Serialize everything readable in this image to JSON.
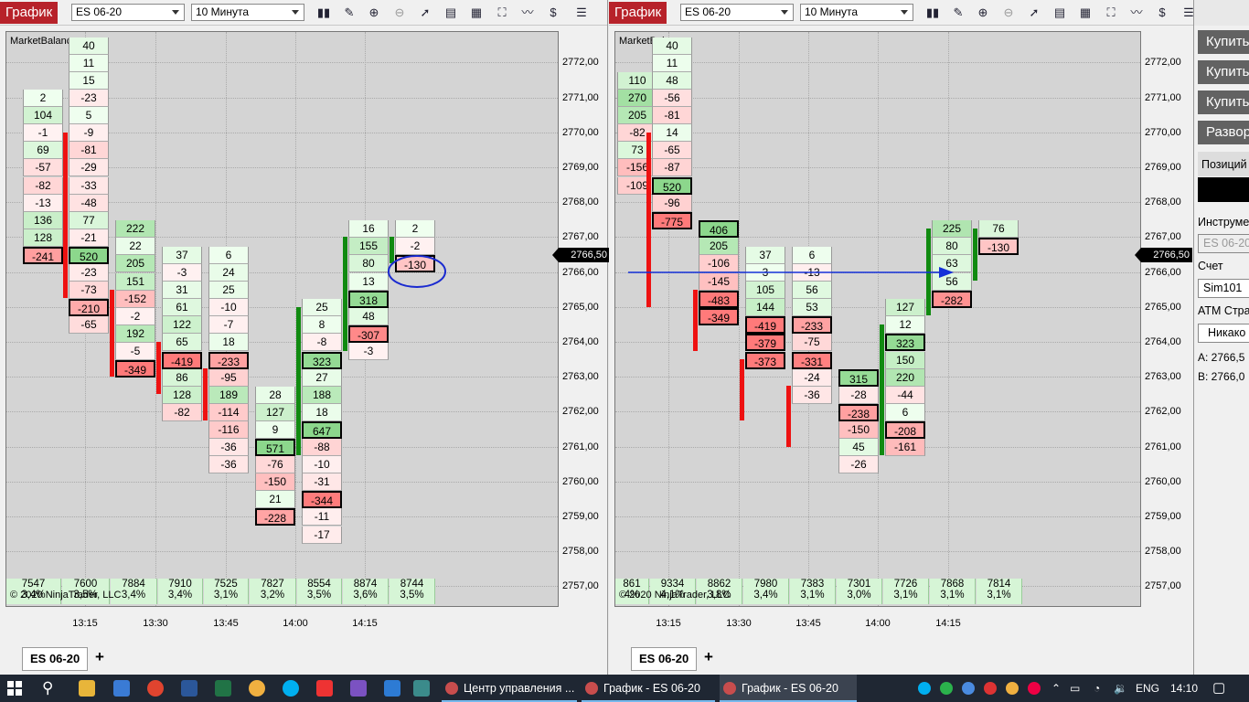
{
  "left": {
    "title": "График",
    "instrument": "ES 06-20",
    "interval": "10 Минута",
    "indicator": "MarketBalance",
    "copyright": "© 2020 NinjaTrader, LLC",
    "tab": "ES 06-20",
    "current_price": "2766,50",
    "times": [
      "13:15",
      "13:30",
      "13:45",
      "14:00",
      "14:15"
    ],
    "sums": [
      {
        "v": "7547",
        "p": "3,4%"
      },
      {
        "v": "7600",
        "p": "3,5%"
      },
      {
        "v": "7884",
        "p": "3,4%"
      },
      {
        "v": "7910",
        "p": "3,4%"
      },
      {
        "v": "7525",
        "p": "3,1%"
      },
      {
        "v": "7827",
        "p": "3,2%"
      },
      {
        "v": "8554",
        "p": "3,5%"
      },
      {
        "v": "8874",
        "p": "3,6%"
      },
      {
        "v": "8744",
        "p": "3,5%"
      }
    ],
    "columns": [
      {
        "top": "2772,00",
        "cells": [
          "",
          "",
          "",
          "",
          "",
          "",
          "",
          ""
        ],
        "bar": null,
        "hide": true
      },
      {
        "top": "2770,75",
        "cells": [
          "2",
          "104",
          "-1",
          "69",
          "-57",
          "-82",
          "-13",
          "136",
          "128",
          "-241"
        ],
        "bar": null
      },
      {
        "top": "2772,25",
        "cells": [
          "40",
          "11",
          "15",
          "-23",
          "5",
          "-9",
          "-81",
          "-29",
          "-33",
          "-48",
          "77",
          "-21",
          "520",
          "-23",
          "-73",
          "-210",
          "-65"
        ],
        "bar": {
          "from": "2769,75",
          "to": "2765,50",
          "c": "red"
        }
      },
      {
        "top": "2767,00",
        "cells": [
          "222",
          "22",
          "205",
          "151",
          "-152",
          "-2",
          "192",
          "-5",
          "-349"
        ],
        "bar": {
          "from": "2765,25",
          "to": "2763,25",
          "c": "red"
        }
      },
      {
        "top": "2766,25",
        "cells": [
          "37",
          "-3",
          "31",
          "61",
          "122",
          "65",
          "-419",
          "86",
          "128",
          "-82"
        ],
        "bar": {
          "from": "2763,75",
          "to": "2762,75",
          "c": "red"
        }
      },
      {
        "top": "2766,25",
        "cells": [
          "6",
          "24",
          "25",
          "-10",
          "-7",
          "18",
          "-233",
          "-95",
          "189",
          "-114",
          "-116",
          "-36",
          "-36"
        ],
        "bar": {
          "from": "2763,00",
          "to": "2762,00",
          "c": "red"
        }
      },
      {
        "top": "2762,25",
        "cells": [
          "28",
          "127",
          "9",
          "571",
          "-76",
          "-150",
          "21",
          "-228"
        ],
        "bar": null
      },
      {
        "top": "2764,75",
        "cells": [
          "25",
          "8",
          "-8",
          "323",
          "27",
          "188",
          "18",
          "647",
          "-88",
          "-10",
          "-31",
          "-344",
          "-11",
          "-17"
        ],
        "bar": {
          "from": "2764,75",
          "to": "2761,00",
          "c": "green"
        }
      },
      {
        "top": "2767,00",
        "cells": [
          "16",
          "155",
          "80",
          "13",
          "318",
          "48",
          "-307",
          "-3"
        ],
        "bar": {
          "from": "2766,75",
          "to": "2764,00",
          "c": "green"
        }
      },
      {
        "top": "2767,00",
        "cells": [
          "2",
          "-2",
          "-130"
        ],
        "bar": {
          "from": "2766,75",
          "to": "2766,50",
          "c": "green"
        }
      }
    ]
  },
  "right": {
    "title": "График",
    "instrument": "ES 06-20",
    "interval": "10 Минута",
    "indicator": "MarketBalance",
    "copyright": "© 2020 NinjaTrader, LLC",
    "tab": "ES 06-20",
    "current_price": "2766,50",
    "times": [
      "13:15",
      "13:30",
      "13:45",
      "14:00",
      "14:15"
    ],
    "sums": [
      {
        "v": "861",
        "p": "4%"
      },
      {
        "v": "9334",
        "p": "4,1%"
      },
      {
        "v": "8862",
        "p": "3,8%"
      },
      {
        "v": "7980",
        "p": "3,4%"
      },
      {
        "v": "7383",
        "p": "3,1%"
      },
      {
        "v": "7301",
        "p": "3,0%"
      },
      {
        "v": "7726",
        "p": "3,1%"
      },
      {
        "v": "7868",
        "p": "3,1%"
      },
      {
        "v": "7814",
        "p": "3,1%"
      }
    ],
    "columns": [
      {
        "top": "2771,25",
        "cells": [
          "110",
          "270",
          "205",
          "-82",
          "73",
          "-156",
          "-109"
        ],
        "bar": null
      },
      {
        "top": "2772,25",
        "cells": [
          "40",
          "11",
          "48",
          "-56",
          "-81",
          "14",
          "-65",
          "-87",
          "520",
          "-96",
          "-775"
        ],
        "bar": {
          "from": "2769,75",
          "to": "2765,25",
          "c": "red"
        }
      },
      {
        "top": "2767,00",
        "cells": [
          "406",
          "205",
          "-106",
          "-145",
          "-483",
          "-349"
        ],
        "bar": {
          "from": "2765,25",
          "to": "2764,00",
          "c": "red"
        }
      },
      {
        "top": "2766,25",
        "cells": [
          "37",
          "3",
          "105",
          "144",
          "-419",
          "-379",
          "-373"
        ],
        "bar": {
          "from": "2763,25",
          "to": "2762,00",
          "c": "red"
        }
      },
      {
        "top": "2766,25",
        "cells": [
          "6",
          "-13",
          "56",
          "53",
          "-233",
          "-75",
          "-331",
          "-24",
          "-36"
        ],
        "bar": {
          "from": "2762,50",
          "to": "2761,25",
          "c": "red"
        }
      },
      {
        "top": "2762,75",
        "cells": [
          "315",
          "-28",
          "-238",
          "-150",
          "45",
          "-26"
        ],
        "bar": null
      },
      {
        "top": "2764,75",
        "cells": [
          "127",
          "12",
          "323",
          "150",
          "220",
          "-44",
          "6",
          "-208",
          "-161"
        ],
        "bar": {
          "from": "2764,25",
          "to": "2761,00",
          "c": "green"
        }
      },
      {
        "top": "2767,00",
        "cells": [
          "225",
          "80",
          "63",
          "56",
          "-282"
        ],
        "bar": {
          "from": "2767,00",
          "to": "2765,00",
          "c": "green"
        }
      },
      {
        "top": "2767,00",
        "cells": [
          "76",
          "-130"
        ],
        "bar": {
          "from": "2767,00",
          "to": "2766,00",
          "c": "green"
        }
      }
    ]
  },
  "prices": [
    "2772,00",
    "2771,00",
    "2770,00",
    "2769,00",
    "2768,00",
    "2767,00",
    "2766,00",
    "2765,00",
    "2764,00",
    "2763,00",
    "2762,00",
    "2761,00",
    "2760,00",
    "2759,00",
    "2758,00",
    "2757,00"
  ],
  "side_panel": {
    "buttons": [
      "Купить",
      "Купить",
      "Купить",
      "Развор"
    ],
    "position_label": "Позиций",
    "instrument_label": "Инструмент",
    "instrument_value": "ES 06-20",
    "account_label": "Счет",
    "account_value": "Sim101",
    "atm_label": "ATM Страт",
    "atm_value": "Никако",
    "ask": "A:  2766,5",
    "bid": "B:  2766,0"
  },
  "taskbar": {
    "items": [
      "Центр управления ...",
      "График - ES 06-20",
      "График - ES 06-20"
    ],
    "lang": "ENG",
    "time": "14:10"
  },
  "colors": {
    "title_red": "#b7222a",
    "buy_green": "#7fd97f",
    "sell_red": "#f7b7b7",
    "bar_red": "#ee1111",
    "bar_green": "#108a10",
    "arrow": "#1530d8"
  }
}
